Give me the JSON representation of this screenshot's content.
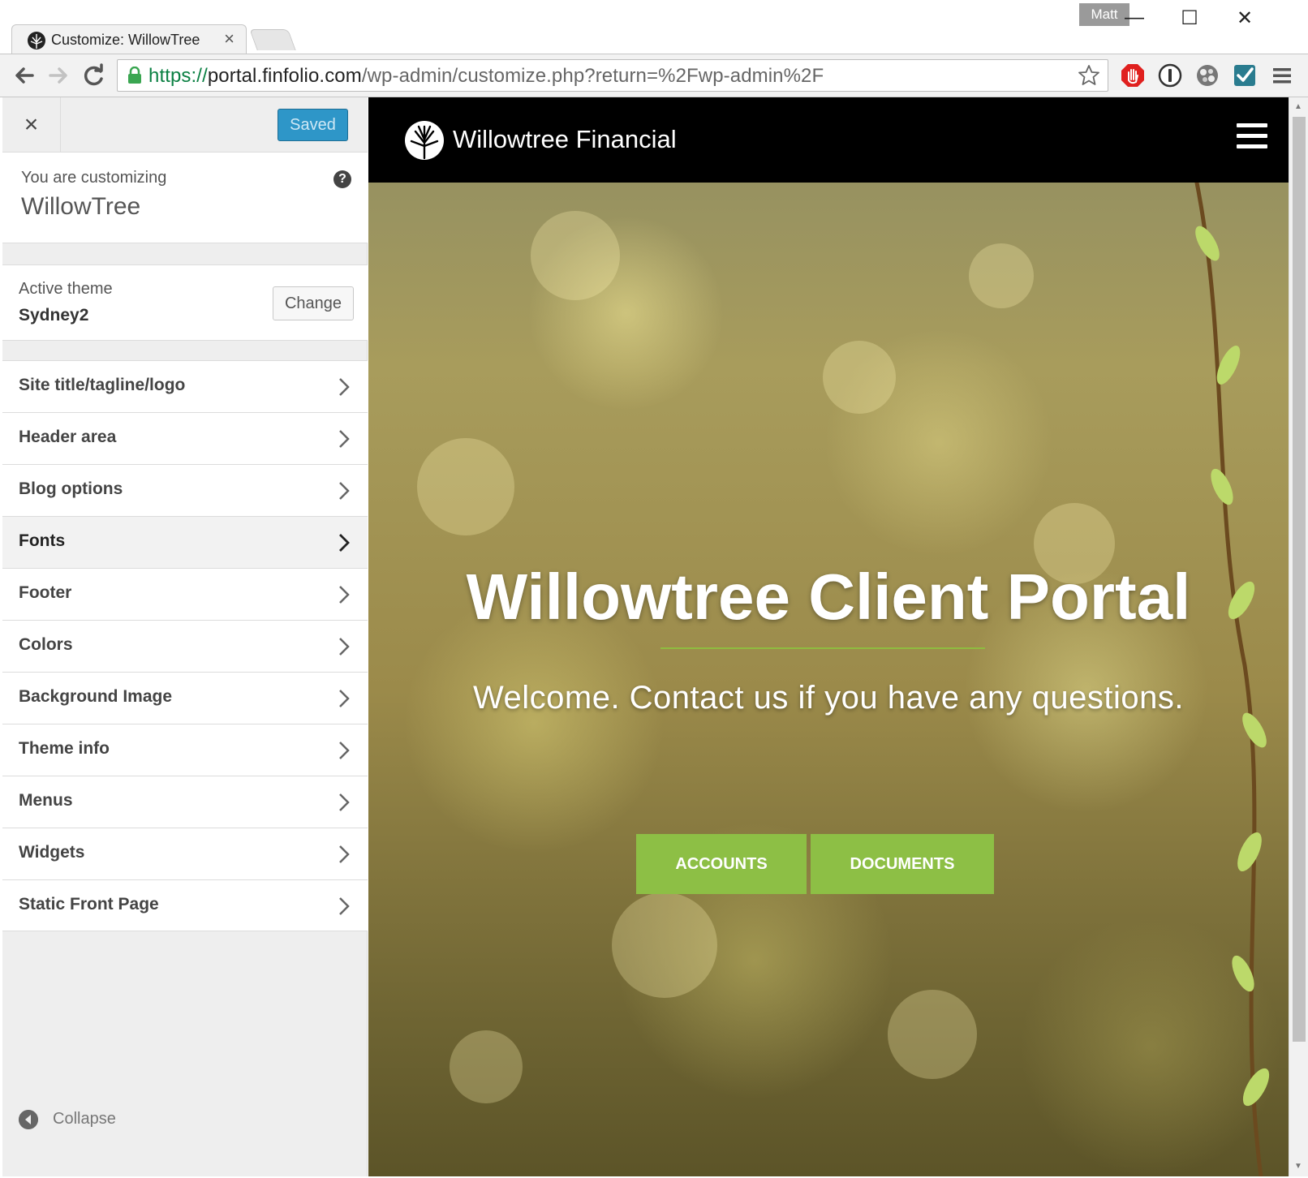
{
  "browser": {
    "tab_title": "Customize: WillowTree",
    "tab_close": "×",
    "profile_name": "Matt",
    "window_controls": {
      "minimize": "—",
      "maximize": "☐",
      "close": "✕"
    },
    "url_scheme": "https://",
    "url_host": "portal.finfolio.com",
    "url_path": "/wp-admin/customize.php?return=%2Fwp-admin%2F",
    "extension_icons": [
      "adblock-icon",
      "onepassword-icon",
      "extension-icon",
      "checkmark-extension-icon",
      "chrome-menu-icon"
    ]
  },
  "customizer": {
    "close_label": "×",
    "saved_label": "Saved",
    "customizing_pre": "You are customizing",
    "customizing_title": "WillowTree",
    "help_label": "?",
    "active_theme_label": "Active theme",
    "active_theme_name": "Sydney2",
    "change_label": "Change",
    "menu": [
      "Site title/tagline/logo",
      "Header area",
      "Blog options",
      "Fonts",
      "Footer",
      "Colors",
      "Background Image",
      "Theme info",
      "Menus",
      "Widgets",
      "Static Front Page"
    ],
    "active_menu_item": "Fonts",
    "collapse_label": "Collapse"
  },
  "preview": {
    "site_name": "Willowtree Financial",
    "hero_title": "Willowtree Client Portal",
    "hero_subtitle": "Welcome. Contact us if you have any questions.",
    "buttons": {
      "accounts": "ACCOUNTS",
      "documents": "DOCUMENTS"
    },
    "accent_color": "#8dbf45",
    "header_color": "#000000"
  },
  "colors": {
    "saved_button": "#2e96c8",
    "sidebar_bg": "#eeeeee"
  }
}
